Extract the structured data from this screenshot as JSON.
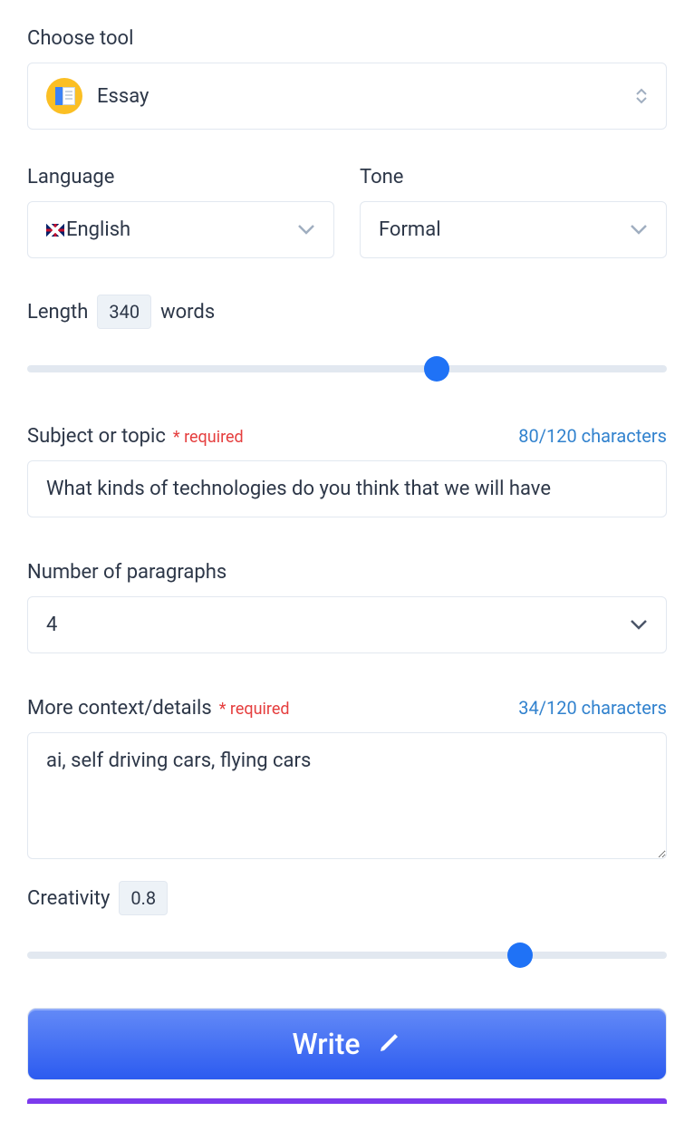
{
  "chooseTool": {
    "label": "Choose tool",
    "value": "Essay"
  },
  "language": {
    "label": "Language",
    "value": "English"
  },
  "tone": {
    "label": "Tone",
    "value": "Formal"
  },
  "length": {
    "label": "Length",
    "value": "340",
    "unit": "words",
    "sliderPercent": 64
  },
  "subject": {
    "label": "Subject or topic",
    "required": "* required",
    "counter": "80/120 characters",
    "value": "What kinds of technologies do you think that we will have"
  },
  "paragraphs": {
    "label": "Number of paragraphs",
    "value": "4"
  },
  "context": {
    "label": "More context/details",
    "required": "* required",
    "counter": "34/120 characters",
    "value": "ai, self driving cars, flying cars"
  },
  "creativity": {
    "label": "Creativity",
    "value": "0.8",
    "sliderPercent": 77
  },
  "writeButton": {
    "label": "Write"
  }
}
